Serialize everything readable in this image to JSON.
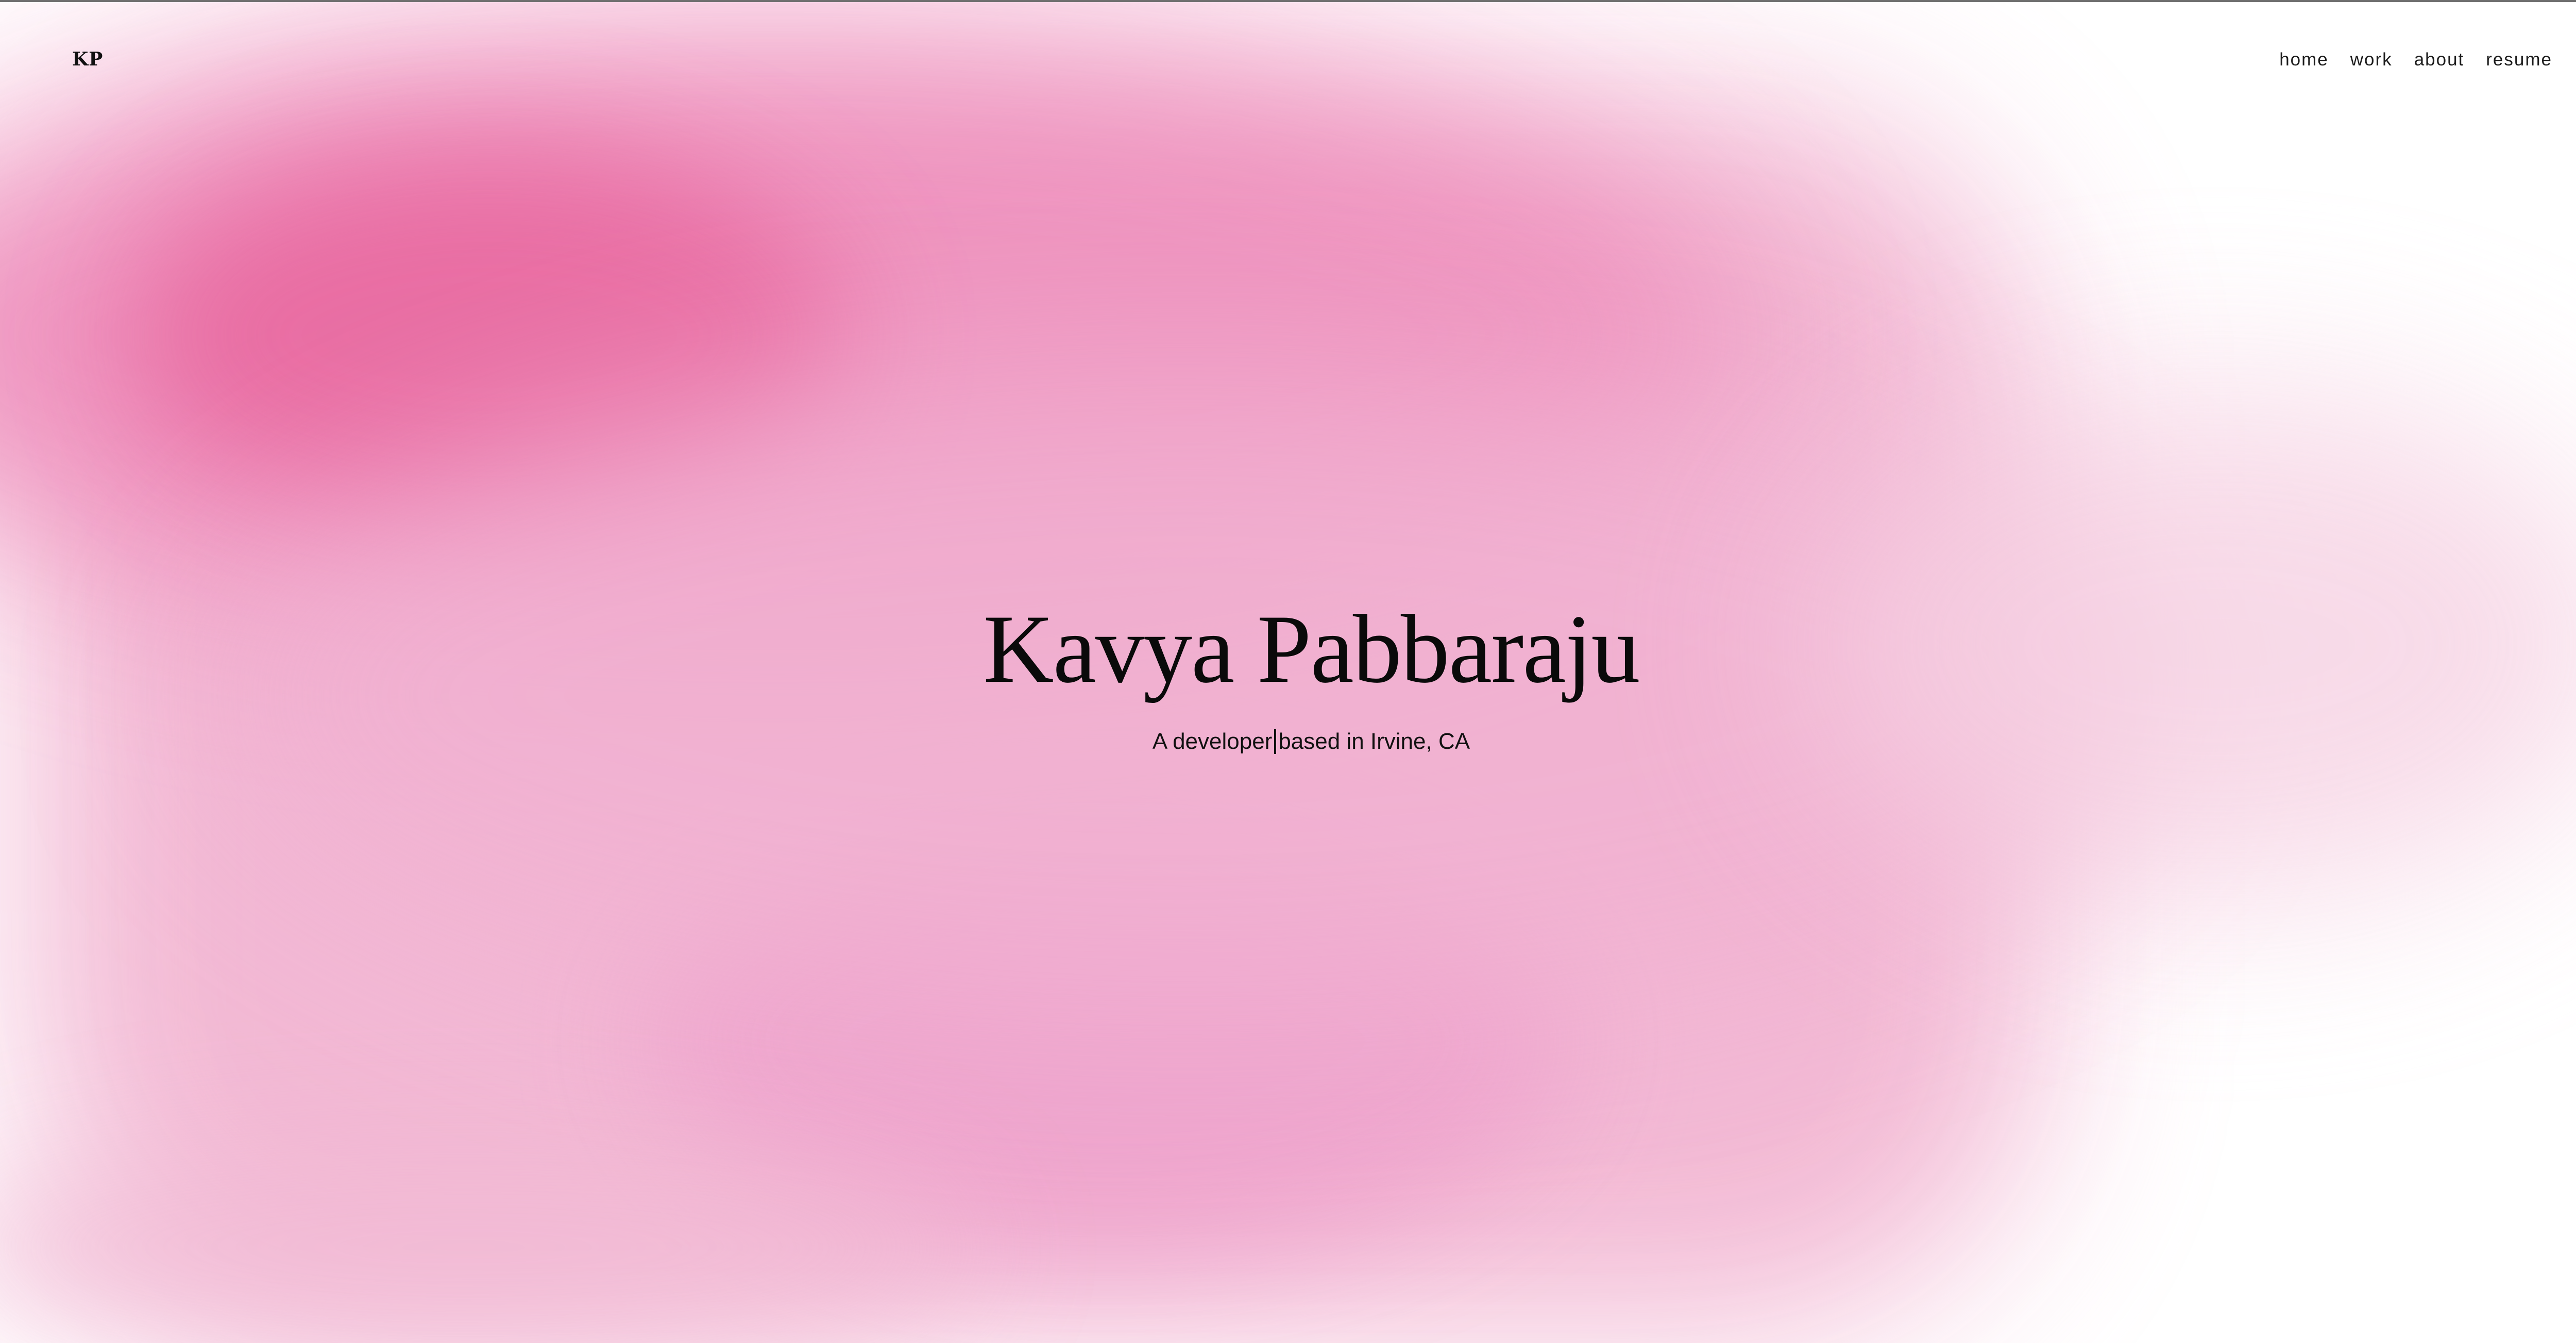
{
  "site": {
    "logo": "KP",
    "nav": [
      {
        "label": "home"
      },
      {
        "label": "work"
      },
      {
        "label": "about"
      },
      {
        "label": "resume"
      }
    ]
  },
  "hero": {
    "name": "Kavya Pabbaraju",
    "subtitle_role": "A developer",
    "subtitle_location": "based in Irvine, CA"
  },
  "colors": {
    "accent_pink": "#ec74a6",
    "soft_pink": "#f3b6d3",
    "text": "#0a0a0a",
    "background": "#ffffff"
  }
}
